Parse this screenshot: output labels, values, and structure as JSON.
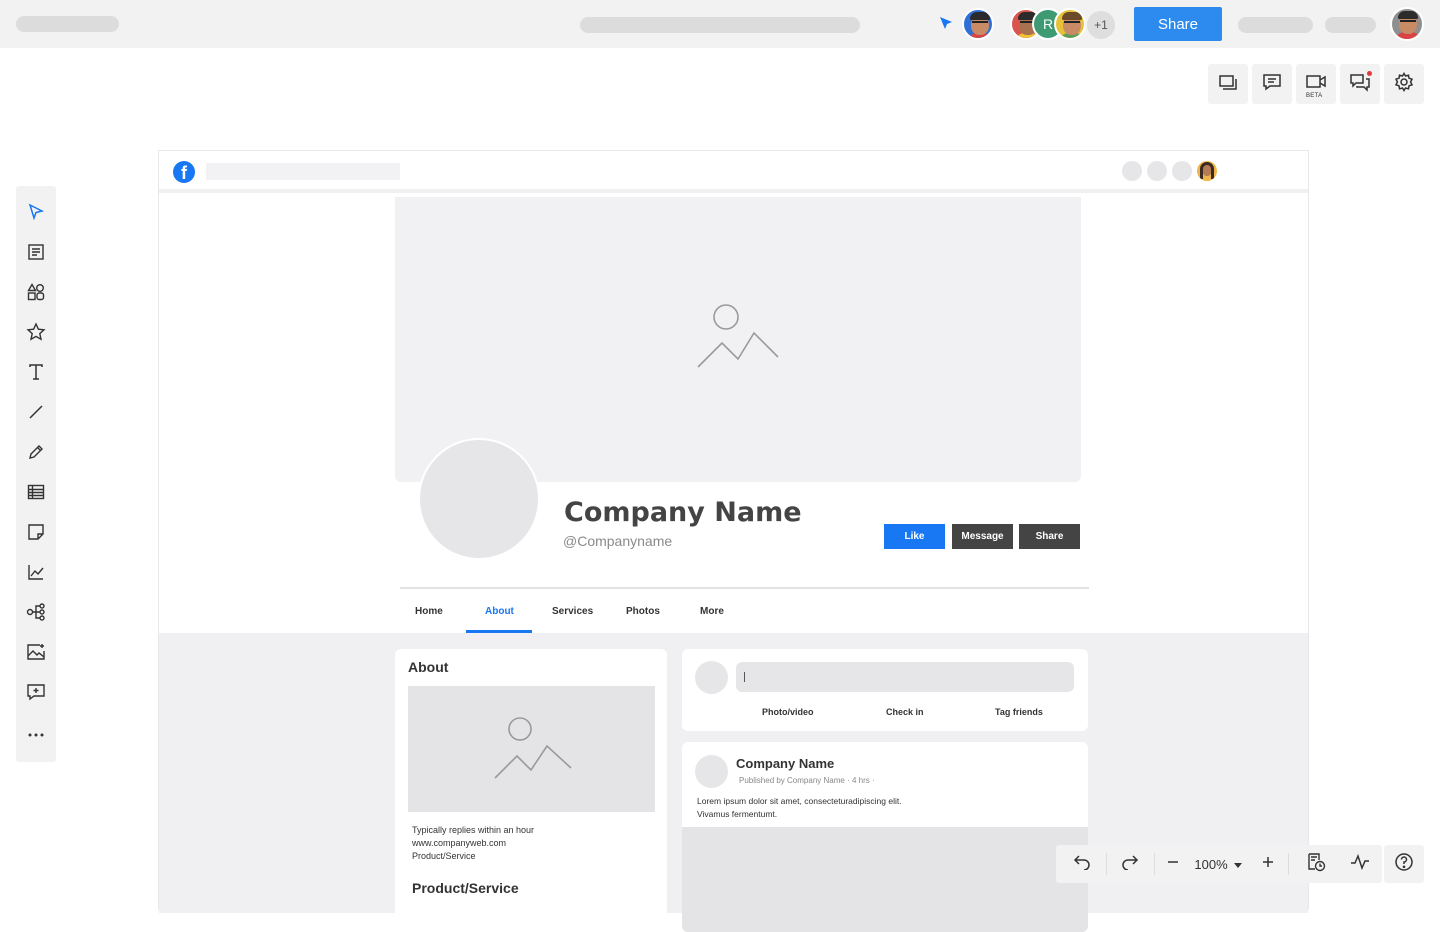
{
  "topbar": {
    "share_label": "Share",
    "collaborators_extra": "+1",
    "collaborator_initial": "R",
    "icons": [
      "cursor-icon",
      "avatar",
      "avatar",
      "avatar",
      "avatar"
    ]
  },
  "right_toolbar": {
    "beta_label": "BETA",
    "buttons": [
      "present-icon",
      "comment-icon",
      "video-icon",
      "chat-icon",
      "gear-icon"
    ]
  },
  "left_toolbar": {
    "tools": [
      "select-icon",
      "document-icon",
      "shapes-icon",
      "star-icon",
      "text-icon",
      "line-icon",
      "pencil-icon",
      "table-icon",
      "sticky-note-icon",
      "chart-icon",
      "mindmap-icon",
      "image-icon",
      "add-comment-icon",
      "more-icon"
    ]
  },
  "mockup": {
    "fb_logo": "f",
    "company_name": "Company Name",
    "handle": "@Companyname",
    "buttons": {
      "like": "Like",
      "message": "Message",
      "share": "Share"
    },
    "tabs": [
      "Home",
      "About",
      "Services",
      "Photos",
      "More"
    ],
    "active_tab": "About",
    "about": {
      "title": "About",
      "lines": [
        "Typically replies within an hour",
        "www.companyweb.com",
        "Product/Service"
      ],
      "section2_title": "Product/Service"
    },
    "composer": {
      "actions": [
        "Photo/video",
        "Check in",
        "Tag friends"
      ]
    },
    "post": {
      "author": "Company Name",
      "meta": "Published by Company Name · 4 hrs ·",
      "text_line1": "Lorem ipsum dolor sit amet, consecteturadipiscing elit.",
      "text_line2": "Vivamus fermentumt."
    },
    "colors": {
      "brand": "#1877f2",
      "dark_button": "#444444",
      "share_button": "#2d8bf0"
    }
  },
  "zoom": {
    "level": "100%"
  }
}
